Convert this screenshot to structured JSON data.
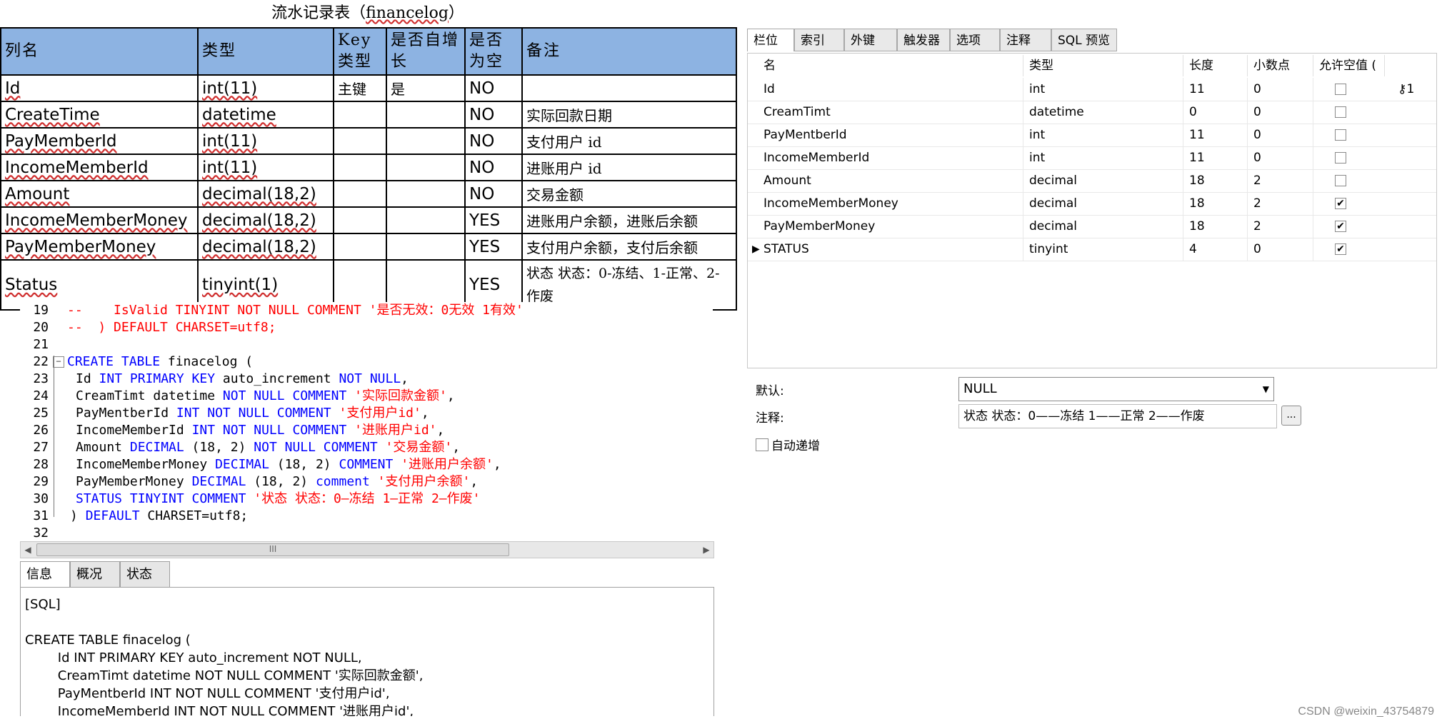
{
  "doc": {
    "title_prefix": "流水记录表（",
    "title_name": "financelog",
    "title_suffix": "）",
    "headers": [
      "列名",
      "类型",
      "Key类型",
      "是否自增长",
      "是否为空",
      "备注"
    ],
    "rows": [
      {
        "name": "Id",
        "type": "int(11)",
        "key": "主键",
        "auto": "是",
        "nullable": "NO",
        "remark": ""
      },
      {
        "name": "CreateTime",
        "type": "datetime",
        "key": "",
        "auto": "",
        "nullable": "NO",
        "remark": "实际回款日期"
      },
      {
        "name": "PayMemberId",
        "type": "int(11)",
        "key": "",
        "auto": "",
        "nullable": "NO",
        "remark": "支付用户 id"
      },
      {
        "name": "IncomeMemberId",
        "type": "int(11)",
        "key": "",
        "auto": "",
        "nullable": "NO",
        "remark": "进账用户 id"
      },
      {
        "name": "Amount",
        "type": "decimal(18,2)",
        "key": "",
        "auto": "",
        "nullable": "NO",
        "remark": "交易金额"
      },
      {
        "name": "IncomeMemberMoney",
        "type": "decimal(18,2)",
        "key": "",
        "auto": "",
        "nullable": "YES",
        "remark": "进账用户余额，进账后余额"
      },
      {
        "name": "PayMemberMoney",
        "type": "decimal(18,2)",
        "key": "",
        "auto": "",
        "nullable": "YES",
        "remark": "支付用户余额，支付后余额"
      },
      {
        "name": "Status",
        "type": "tinyint(1)",
        "key": "",
        "auto": "",
        "nullable": "YES",
        "remark": "状态 状态：0-冻结、1-正常、2-作废"
      }
    ]
  },
  "editor": {
    "lines": [
      {
        "n": "19",
        "parts": [
          [
            "cm",
            "--    IsValid TINYINT NOT NULL COMMENT '是否无效：0无效 1有效'"
          ]
        ]
      },
      {
        "n": "20",
        "parts": [
          [
            "cm",
            "--  ) DEFAULT CHARSET=utf8;"
          ]
        ]
      },
      {
        "n": "21",
        "parts": []
      },
      {
        "n": "22",
        "fold": true,
        "parts": [
          [
            "kw",
            "CREATE TABLE"
          ],
          [
            "tx",
            " finacelog ("
          ]
        ]
      },
      {
        "n": "23",
        "parts": [
          [
            "tx",
            "Id "
          ],
          [
            "kw",
            "INT PRIMARY KEY"
          ],
          [
            "tx",
            " auto_increment "
          ],
          [
            "kw",
            "NOT NULL"
          ],
          [
            "tx",
            ","
          ]
        ]
      },
      {
        "n": "24",
        "parts": [
          [
            "tx",
            "CreamTimt datetime "
          ],
          [
            "kw",
            "NOT NULL COMMENT"
          ],
          [
            "tx",
            " "
          ],
          [
            "st",
            "'实际回款金额'"
          ],
          [
            "tx",
            ","
          ]
        ]
      },
      {
        "n": "25",
        "parts": [
          [
            "tx",
            "PayMentberId "
          ],
          [
            "kw",
            "INT NOT NULL COMMENT"
          ],
          [
            "tx",
            " "
          ],
          [
            "st",
            "'支付用户id'"
          ],
          [
            "tx",
            ","
          ]
        ]
      },
      {
        "n": "26",
        "parts": [
          [
            "tx",
            "IncomeMemberId "
          ],
          [
            "kw",
            "INT NOT NULL COMMENT"
          ],
          [
            "tx",
            " "
          ],
          [
            "st",
            "'进账用户id'"
          ],
          [
            "tx",
            ","
          ]
        ]
      },
      {
        "n": "27",
        "parts": [
          [
            "tx",
            "Amount "
          ],
          [
            "kw",
            "DECIMAL"
          ],
          [
            "tx",
            " (18, 2) "
          ],
          [
            "kw",
            "NOT NULL COMMENT"
          ],
          [
            "tx",
            " "
          ],
          [
            "st",
            "'交易金额'"
          ],
          [
            "tx",
            ","
          ]
        ]
      },
      {
        "n": "28",
        "parts": [
          [
            "tx",
            "IncomeMemberMoney "
          ],
          [
            "kw",
            "DECIMAL"
          ],
          [
            "tx",
            " (18, 2) "
          ],
          [
            "kw",
            "COMMENT"
          ],
          [
            "tx",
            " "
          ],
          [
            "st",
            "'进账用户余额'"
          ],
          [
            "tx",
            ","
          ]
        ]
      },
      {
        "n": "29",
        "parts": [
          [
            "tx",
            "PayMemberMoney "
          ],
          [
            "kw",
            "DECIMAL"
          ],
          [
            "tx",
            " (18, 2) "
          ],
          [
            "kw",
            "comment"
          ],
          [
            "tx",
            " "
          ],
          [
            "st",
            "'支付用户余额'"
          ],
          [
            "tx",
            ","
          ]
        ]
      },
      {
        "n": "30",
        "parts": [
          [
            "kw",
            "STATUS TINYINT COMMENT"
          ],
          [
            "tx",
            " "
          ],
          [
            "st",
            "'状态 状态：0—冻结 1—正常 2—作废'"
          ]
        ]
      },
      {
        "n": "31",
        "parts": [
          [
            "tx",
            ") "
          ],
          [
            "kw",
            "DEFAULT"
          ],
          [
            "tx",
            " CHARSET=utf8;"
          ]
        ]
      },
      {
        "n": "32",
        "parts": []
      }
    ],
    "scroll_thumb": "III"
  },
  "bottom": {
    "tabs": [
      "信息",
      "概况",
      "状态"
    ],
    "lines": [
      "[SQL]",
      "",
      "CREATE TABLE finacelog (",
      "        Id INT PRIMARY KEY auto_increment NOT NULL,",
      "        CreamTimt datetime NOT NULL COMMENT '实际回款金额',",
      "        PayMentberId INT NOT NULL COMMENT '支付用户id',",
      "        IncomeMemberId INT NOT NULL COMMENT '进账用户id',"
    ]
  },
  "navicat": {
    "tabs": [
      "栏位",
      "索引",
      "外键",
      "触发器",
      "选项",
      "注释",
      "SQL 预览"
    ],
    "columns": [
      "名",
      "类型",
      "长度",
      "小数点",
      "允许空值 ("
    ],
    "rows": [
      {
        "name": "Id",
        "type": "int",
        "length": "11",
        "decimals": "0",
        "allow_null": false,
        "key": "1"
      },
      {
        "name": "CreamTimt",
        "type": "datetime",
        "length": "0",
        "decimals": "0",
        "allow_null": false
      },
      {
        "name": "PayMentberId",
        "type": "int",
        "length": "11",
        "decimals": "0",
        "allow_null": false
      },
      {
        "name": "IncomeMemberId",
        "type": "int",
        "length": "11",
        "decimals": "0",
        "allow_null": false
      },
      {
        "name": "Amount",
        "type": "decimal",
        "length": "18",
        "decimals": "2",
        "allow_null": false
      },
      {
        "name": "IncomeMemberMoney",
        "type": "decimal",
        "length": "18",
        "decimals": "2",
        "allow_null": true
      },
      {
        "name": "PayMemberMoney",
        "type": "decimal",
        "length": "18",
        "decimals": "2",
        "allow_null": true
      },
      {
        "name": "STATUS",
        "type": "tinyint",
        "length": "4",
        "decimals": "0",
        "allow_null": true,
        "current": true
      }
    ],
    "default_label": "默认:",
    "default_value": "NULL",
    "comment_label": "注释:",
    "comment_value": "状态 状态：0——冻结 1——正常 2——作废",
    "ellipsis": "...",
    "auto_increment_label": "自动递增"
  },
  "watermark": "CSDN @weixin_43754879"
}
